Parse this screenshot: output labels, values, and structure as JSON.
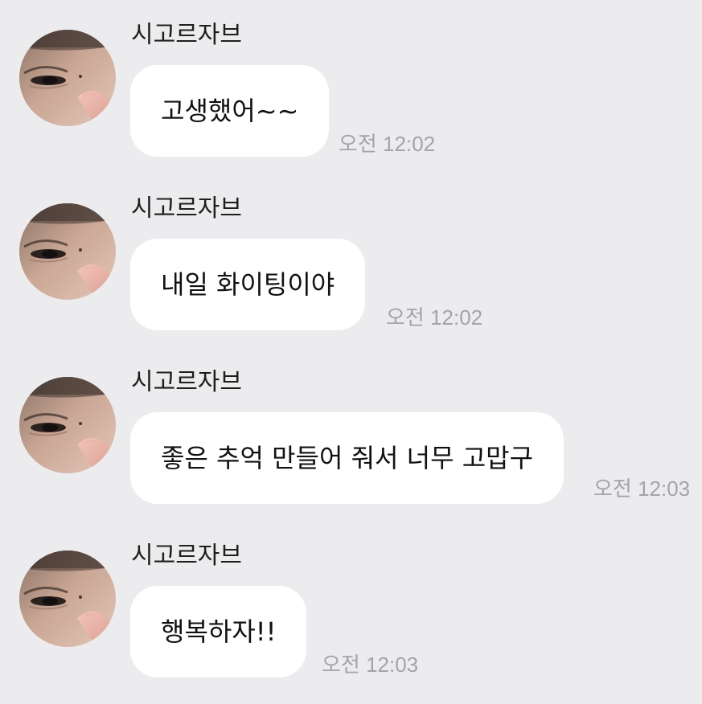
{
  "messages": [
    {
      "sender": "시고르자브",
      "text": "고생했어~~",
      "time": "오전 12:02"
    },
    {
      "sender": "시고르자브",
      "text": "내일 화이팅이야",
      "time": "오전 12:02"
    },
    {
      "sender": "시고르자브",
      "text": "좋은 추억 만들어 줘서 너무 고맙구",
      "time": "오전 12:03"
    },
    {
      "sender": "시고르자브",
      "text": "행복하자!!",
      "time": "오전 12:03"
    }
  ]
}
